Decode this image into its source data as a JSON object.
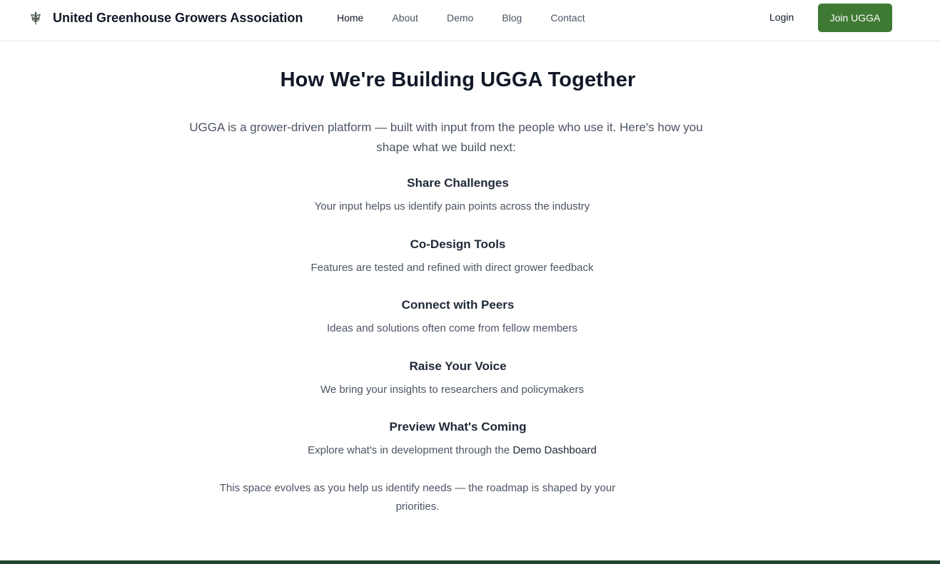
{
  "header": {
    "brand_name": "United Greenhouse Growers Association",
    "logo_icon": "leaf-sprout-icon",
    "nav": [
      {
        "label": "Home",
        "active": true
      },
      {
        "label": "About",
        "active": false
      },
      {
        "label": "Demo",
        "active": false
      },
      {
        "label": "Blog",
        "active": false
      },
      {
        "label": "Contact",
        "active": false
      }
    ],
    "login_label": "Login",
    "join_label": "Join UGGA"
  },
  "main": {
    "title": "How We're Building UGGA Together",
    "intro": "UGGA is a grower-driven platform — built with input from the people who use it. Here's how you shape what we build next:",
    "steps": [
      {
        "title": "Share Challenges",
        "description": "Your input helps us identify pain points across the industry"
      },
      {
        "title": "Co-Design Tools",
        "description": "Features are tested and refined with direct grower feedback"
      },
      {
        "title": "Connect with Peers",
        "description": "Ideas and solutions often come from fellow members"
      },
      {
        "title": "Raise Your Voice",
        "description": "We bring your insights to researchers and policymakers"
      },
      {
        "title": "Preview What's Coming",
        "description": "Explore what's in development through the",
        "link_label": "Demo Dashboard"
      }
    ],
    "footnote": "This space evolves as you help us identify needs — the roadmap is shaped by your priorities."
  },
  "colors": {
    "brand_green": "#3f7a34",
    "footer_green": "#1f4530",
    "heading": "#111827",
    "body_text": "#4b5563"
  }
}
